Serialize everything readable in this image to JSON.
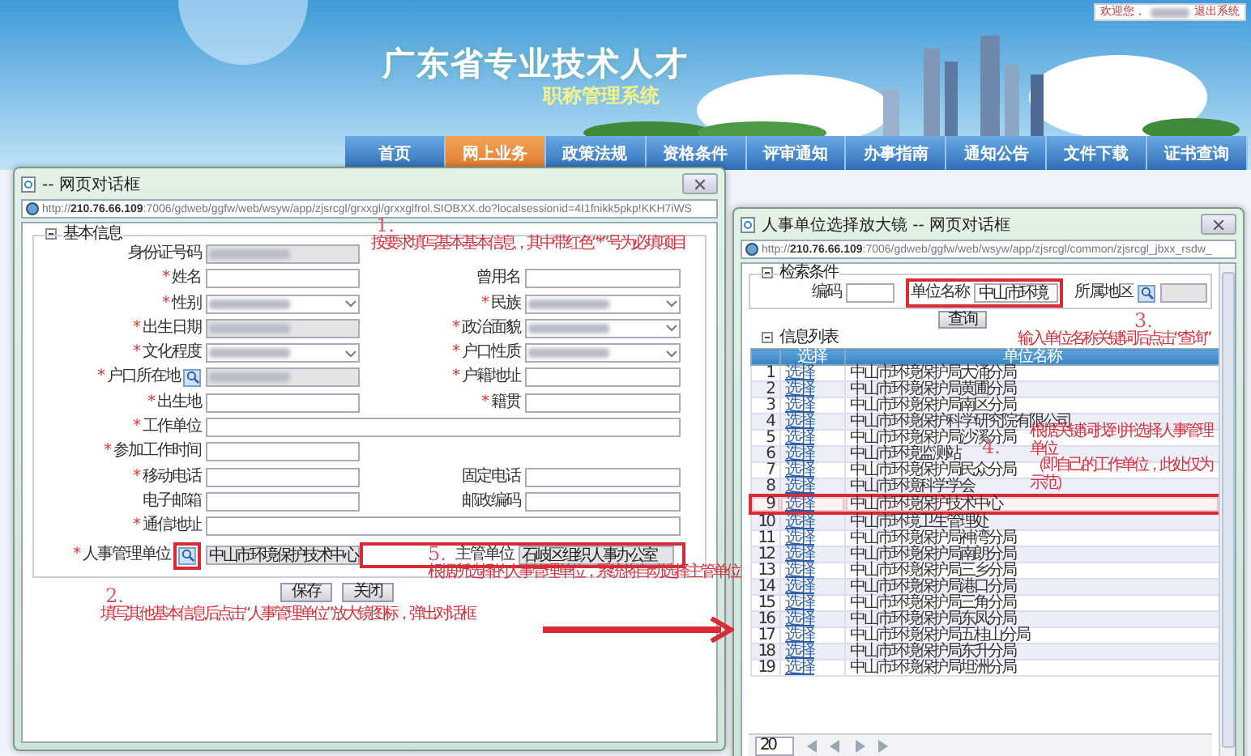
{
  "banner": {
    "title": "广东省专业技术人才",
    "subtitle": "职称管理系统",
    "welcome": "欢迎您，",
    "user_redacted": true,
    "logout": "退出系统"
  },
  "nav": [
    {
      "label": "首页",
      "selected": false
    },
    {
      "label": "网上业务",
      "selected": true
    },
    {
      "label": "政策法规",
      "selected": false
    },
    {
      "label": "资格条件",
      "selected": false
    },
    {
      "label": "评审通知",
      "selected": false
    },
    {
      "label": "办事指南",
      "selected": false
    },
    {
      "label": "通知公告",
      "selected": false
    },
    {
      "label": "文件下载",
      "selected": false
    },
    {
      "label": "证书查询",
      "selected": false
    }
  ],
  "left_dialog": {
    "title": "-- 网页对话框",
    "url": "http://**210.76.66.109**:7006/gdweb/ggfw/web/wsyw/app/zjsrcgl/grxxgl/grxxglfrol.SIOBXX.do?localsessionid=4I1fnikk5pkp!KKH7iWS",
    "section": "基本信息",
    "rows": [
      [
        {
          "label": "身份证号码",
          "kind": "text",
          "readonly": true,
          "redacted": true
        }
      ],
      [
        {
          "mark": "*",
          "label": "姓名",
          "kind": "text",
          "readonly": false,
          "redacted": false
        },
        {
          "label": "曾用名",
          "kind": "text",
          "readonly": false,
          "redacted": false
        }
      ],
      [
        {
          "mark": "*",
          "label": "性别",
          "kind": "select",
          "readonly": false,
          "redacted": true
        },
        {
          "mark": "*",
          "label": "民族",
          "kind": "select",
          "readonly": false,
          "redacted": true
        }
      ],
      [
        {
          "mark": "*",
          "label": "出生日期",
          "kind": "text",
          "readonly": true,
          "redacted": true
        },
        {
          "mark": "*",
          "label": "政治面貌",
          "kind": "select",
          "readonly": false,
          "redacted": true
        }
      ],
      [
        {
          "mark": "*",
          "label": "文化程度",
          "kind": "select",
          "readonly": false,
          "redacted": true
        },
        {
          "mark": "*",
          "label": "户口性质",
          "kind": "select",
          "readonly": false,
          "redacted": true
        }
      ],
      [
        {
          "mark": "*",
          "label": "户口所在地",
          "kind": "text",
          "readonly": true,
          "redacted": true,
          "lookup": true
        },
        {
          "mark": "*",
          "label": "户籍地址",
          "kind": "text",
          "readonly": false,
          "redacted": false
        }
      ],
      [
        {
          "mark": "*",
          "label": "出生地",
          "kind": "text",
          "readonly": false,
          "redacted": false
        },
        {
          "mark": "*",
          "label": "籍贯",
          "kind": "text",
          "readonly": false,
          "redacted": false
        }
      ],
      [
        {
          "mark": "*",
          "label": "工作单位",
          "kind": "text",
          "readonly": false,
          "redacted": false,
          "wide": true
        }
      ],
      [
        {
          "mark": "*",
          "label": "参加工作时间",
          "kind": "text",
          "readonly": false,
          "redacted": false
        }
      ],
      [
        {
          "mark": "*",
          "label": "移动电话",
          "kind": "text",
          "readonly": false,
          "redacted": false
        },
        {
          "label": "固定电话",
          "kind": "text",
          "readonly": false,
          "redacted": false
        }
      ],
      [
        {
          "label": "电子邮箱",
          "kind": "text",
          "readonly": false,
          "redacted": false
        },
        {
          "label": "邮政编码",
          "kind": "text",
          "readonly": false,
          "redacted": false
        }
      ],
      [
        {
          "mark": "*",
          "label": "通信地址",
          "kind": "text",
          "readonly": false,
          "redacted": false,
          "wide": true
        }
      ],
      [
        {
          "mark": "*",
          "label": "人事管理单位",
          "kind": "text",
          "readonly": true,
          "redacted": false,
          "lookup": true,
          "lookup_highlighted": true,
          "value": "中山市环境保护技术中心"
        },
        {
          "label": "主管单位",
          "kind": "text",
          "readonly": true,
          "redacted": false,
          "highlighted": true,
          "value": "石岐区组织人事办公室"
        }
      ]
    ],
    "buttons": [
      "保存",
      "关闭"
    ]
  },
  "right_dialog": {
    "title": "人事单位选择放大镜 -- 网页对话框",
    "url": "http://**210.76.66.109**:7006/gdweb/ggfw/web/wsyw/app/zjsrcgl/common/zjsrcgl_jbxx_rsdw_",
    "search_section": "检索条件",
    "search_fields": [
      {
        "label": "编码",
        "readonly": false,
        "highlighted": false
      },
      {
        "label": "单位名称",
        "readonly": false,
        "highlighted": true,
        "value": "中山市环境"
      },
      {
        "label": "所属地区",
        "readonly": true,
        "highlighted": false,
        "lookup": true
      }
    ],
    "search_button": "查询",
    "list_section": "信息列表",
    "columns": [
      "选择",
      "单位名称"
    ],
    "rows": [
      {
        "index": "1",
        "action": "选择",
        "name": "中山市环境保护局大涌分局",
        "highlighted": false
      },
      {
        "index": "2",
        "action": "选择",
        "name": "中山市环境保护局黄圃分局",
        "highlighted": false
      },
      {
        "index": "3",
        "action": "选择",
        "name": "中山市环境保护局南区分局",
        "highlighted": false
      },
      {
        "index": "4",
        "action": "选择",
        "name": "中山市环境保护科学研究院有限公司",
        "highlighted": false
      },
      {
        "index": "5",
        "action": "选择",
        "name": "中山市环境保护局沙溪分局",
        "highlighted": false
      },
      {
        "index": "6",
        "action": "选择",
        "name": "中山市环境监测站",
        "highlighted": false
      },
      {
        "index": "7",
        "action": "选择",
        "name": "中山市环境保护局民众分局",
        "highlighted": false
      },
      {
        "index": "8",
        "action": "选择",
        "name": "中山市环境科学学会",
        "highlighted": false
      },
      {
        "index": "9",
        "action": "选择",
        "name": "中山市环境保护技术中心",
        "highlighted": true
      },
      {
        "index": "10",
        "action": "选择",
        "name": "中山市环境卫生管理处",
        "highlighted": false
      },
      {
        "index": "11",
        "action": "选择",
        "name": "中山市环境保护局神湾分局",
        "highlighted": false
      },
      {
        "index": "12",
        "action": "选择",
        "name": "中山市环境保护局南朗分局",
        "highlighted": false
      },
      {
        "index": "13",
        "action": "选择",
        "name": "中山市环境保护局三乡分局",
        "highlighted": false
      },
      {
        "index": "14",
        "action": "选择",
        "name": "中山市环境保护局港口分局",
        "highlighted": false
      },
      {
        "index": "15",
        "action": "选择",
        "name": "中山市环境保护局三角分局",
        "highlighted": false
      },
      {
        "index": "16",
        "action": "选择",
        "name": "中山市环境保护局东凤分局",
        "highlighted": false
      },
      {
        "index": "17",
        "action": "选择",
        "name": "中山市环境保护局五桂山分局",
        "highlighted": false
      },
      {
        "index": "18",
        "action": "选择",
        "name": "中山市环境保护局东升分局",
        "highlighted": false
      },
      {
        "index": "19",
        "action": "选择",
        "name": "中山市环境保护局坦洲分局",
        "highlighted": false
      }
    ],
    "pager": {
      "page_size": "20"
    }
  },
  "annotations": [
    {
      "number": "1.",
      "lines": [
        "按要求填写基本基本信息，其中带红色“*”号为必填项目"
      ]
    },
    {
      "number": "2.",
      "lines": [
        "填写其他基本信息后点击“人事管理单位”放大镜图标，弹出对话框"
      ]
    },
    {
      "number": "3.",
      "lines": [
        "输入单位名称关键词后点击“查询”"
      ]
    },
    {
      "number": "4.",
      "lines": [
        "根据关键词找到并选择人事管理单位",
        "（即自己的工作单位，此处仅为示范）"
      ]
    },
    {
      "number": "5.",
      "lines": [
        "根据所选择的人事管理单位，系统将自动选择主管单位"
      ]
    }
  ]
}
